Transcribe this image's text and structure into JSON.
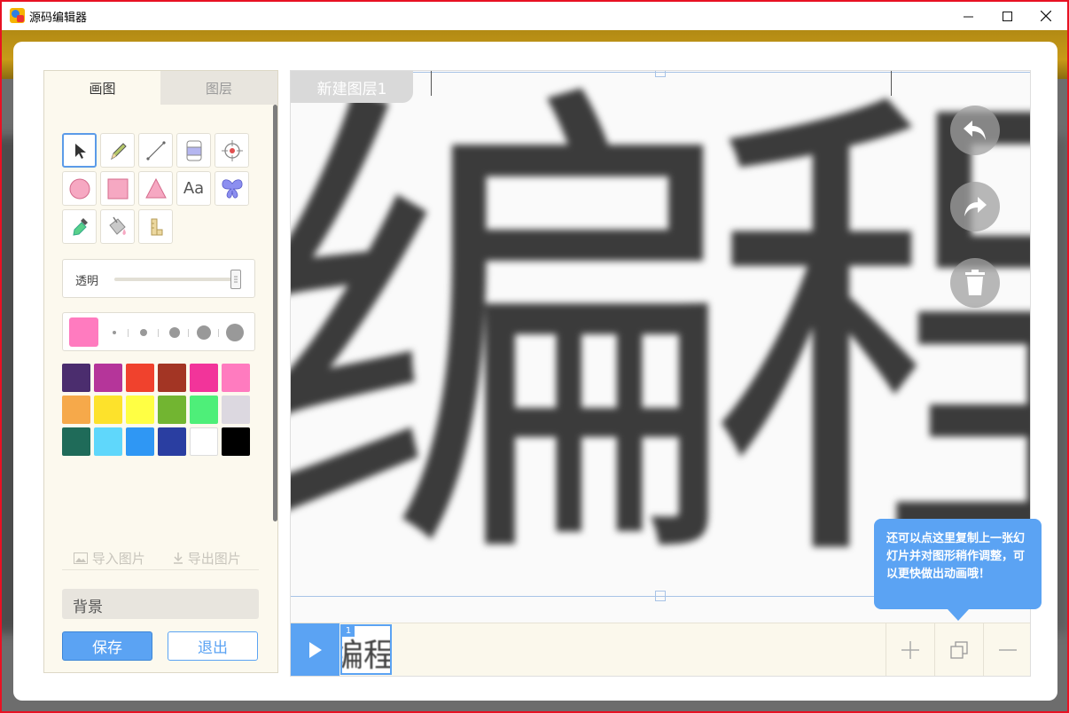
{
  "window": {
    "title": "源码编辑器",
    "minimize": "—",
    "maximize": "☐",
    "close": "✕"
  },
  "left_panel": {
    "tabs": [
      {
        "label": "画图",
        "active": true
      },
      {
        "label": "图层",
        "active": false
      }
    ],
    "tools": [
      {
        "name": "pointer-tool-icon"
      },
      {
        "name": "pencil-tool-icon"
      },
      {
        "name": "line-tool-icon"
      },
      {
        "name": "eraser-tool-icon"
      },
      {
        "name": "crosshair-tool-icon"
      },
      {
        "name": "circle-tool-icon"
      },
      {
        "name": "rectangle-tool-icon"
      },
      {
        "name": "triangle-tool-icon"
      },
      {
        "name": "text-tool-icon",
        "label": "Aa"
      },
      {
        "name": "butterfly-sticker-icon"
      },
      {
        "name": "eyedropper-tool-icon"
      },
      {
        "name": "paint-bucket-icon"
      },
      {
        "name": "ruler-tool-icon"
      }
    ],
    "opacity": {
      "label": "透明",
      "value": 1.0
    },
    "brush": {
      "current_color": "#ff7bbf",
      "sizes": [
        1,
        2,
        3,
        4,
        5
      ]
    },
    "palette": [
      "#4b2d6e",
      "#b5359a",
      "#f0422d",
      "#a33524",
      "#f2349a",
      "#ff7bbf",
      "#f6a94a",
      "#fde22b",
      "#ffff44",
      "#72b531",
      "#4eef79",
      "#dcd8e0",
      "#1f6b59",
      "#5fd7fb",
      "#2f97f4",
      "#2a3ea1",
      "#ffffff",
      "#000000"
    ],
    "import_label": "导入图片",
    "export_label": "导出图片",
    "background_label": "背景",
    "save_label": "保存",
    "exit_label": "退出"
  },
  "canvas": {
    "layer_name": "新建图层1",
    "text_content": "编程猫",
    "tooltip": "还可以点这里复制上一张幻灯片并对图形稍作调整，可以更快做出动画哦！"
  },
  "timeline": {
    "frames": [
      {
        "number": "1",
        "preview_text": "编程猫"
      }
    ],
    "add_label": "+",
    "minus_label": "—"
  }
}
